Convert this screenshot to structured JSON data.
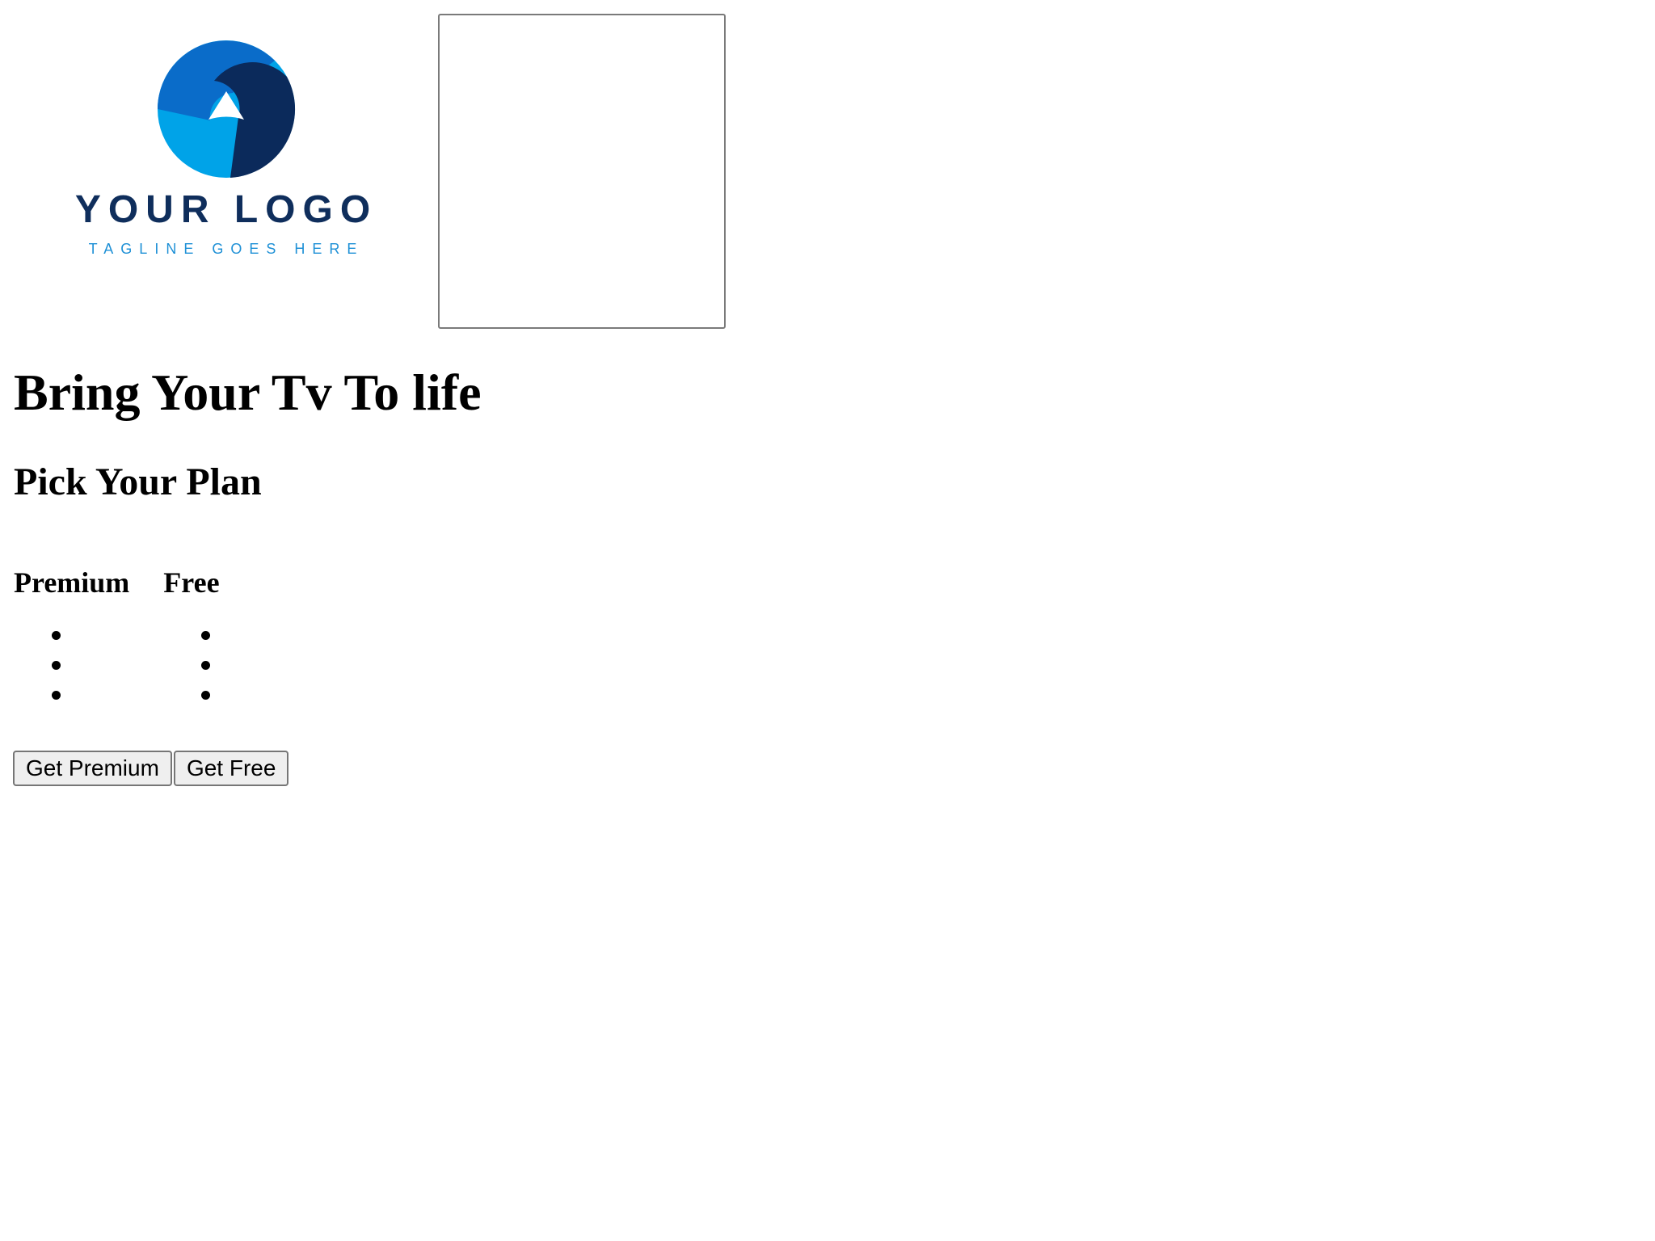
{
  "logo": {
    "name": "YOUR LOGO",
    "tagline": "TAGLINE GOES HERE",
    "colors": {
      "light_blue": "#00a3e8",
      "mid_blue": "#0a6cc9",
      "dark_navy": "#0b2a5b"
    }
  },
  "hero": {
    "title": "Bring Your Tv To life"
  },
  "plans_section": {
    "heading": "Pick Your Plan",
    "plans": [
      {
        "name": "Premium",
        "features": [
          "",
          "",
          ""
        ]
      },
      {
        "name": "Free",
        "features": [
          "",
          "",
          ""
        ]
      }
    ]
  },
  "buttons": {
    "premium_label": "Get Premium",
    "free_label": "Get Free"
  }
}
